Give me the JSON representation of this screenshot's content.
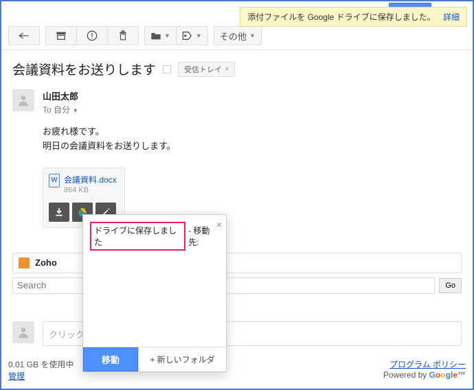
{
  "notification": {
    "text": "添付ファイルを Google ドライブに保存しました。",
    "link": "詳細"
  },
  "toolbar": {
    "more": "その他"
  },
  "subject": "会議資料をお送りします",
  "inbox_tag": "受信トレイ",
  "sender": {
    "name": "山田太郎",
    "to_prefix": "To",
    "to_value": "自分"
  },
  "body": {
    "line1": "お疲れ様です。",
    "line2": "明日の会議資料をお送りします。"
  },
  "attachment": {
    "name": "会議資料.docx",
    "size": "864 KB",
    "icon_letter": "W"
  },
  "zoho": {
    "label": "Zoho"
  },
  "search": {
    "placeholder": "Search",
    "go": "Go"
  },
  "reply": {
    "placeholder": "クリックし"
  },
  "popup": {
    "saved": "ドライブに保存しました",
    "move_label": "- 移動先:",
    "move_btn": "移動",
    "new_folder": "+ 新しいフォルダ"
  },
  "footer": {
    "storage1": "0.01 GB を使用中",
    "storage2": "管理",
    "policy": "プログラム ポリシー",
    "powered": "Powered by ",
    "google": "Google™"
  }
}
